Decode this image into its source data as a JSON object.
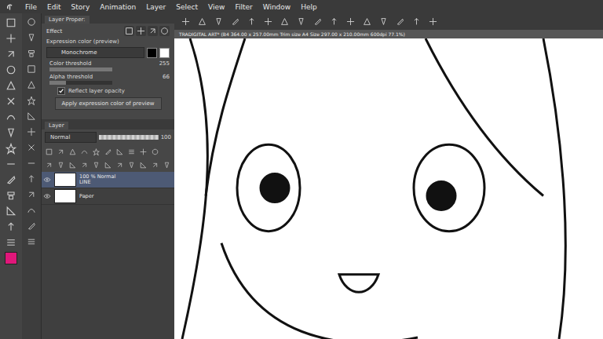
{
  "menu": [
    "File",
    "Edit",
    "Story",
    "Animation",
    "Layer",
    "Select",
    "View",
    "Filter",
    "Window",
    "Help"
  ],
  "document_tab": {
    "title": "TRADIGITAL ART* (B4 364.00 x 257.00mm Trim size A4 Size 297.00 x 210.00mm 600dpi 77.1%)"
  },
  "main_color": "#e0177a",
  "layer_property": {
    "tab": "Layer Proper:",
    "section": "Effect",
    "expression_label": "Expression color (preview)",
    "expression_mode": "Monochrome",
    "sliders": [
      {
        "label": "Color threshold",
        "value": "255",
        "level": 1.0
      },
      {
        "label": "Alpha threshold",
        "value": "66",
        "level": 0.26
      }
    ],
    "reflect_opacity": {
      "label": "Reflect layer opacity",
      "checked": true
    },
    "apply_button": "Apply expression color of preview"
  },
  "layer_panel": {
    "tab": "Layer",
    "blend_mode": "Normal",
    "opacity": "100",
    "opacity_level": 1.0,
    "layers": [
      {
        "name": "LINE",
        "info": "100 % Normal",
        "selected": true,
        "visible": true
      },
      {
        "name": "Paper",
        "selected": false,
        "visible": true
      }
    ]
  }
}
